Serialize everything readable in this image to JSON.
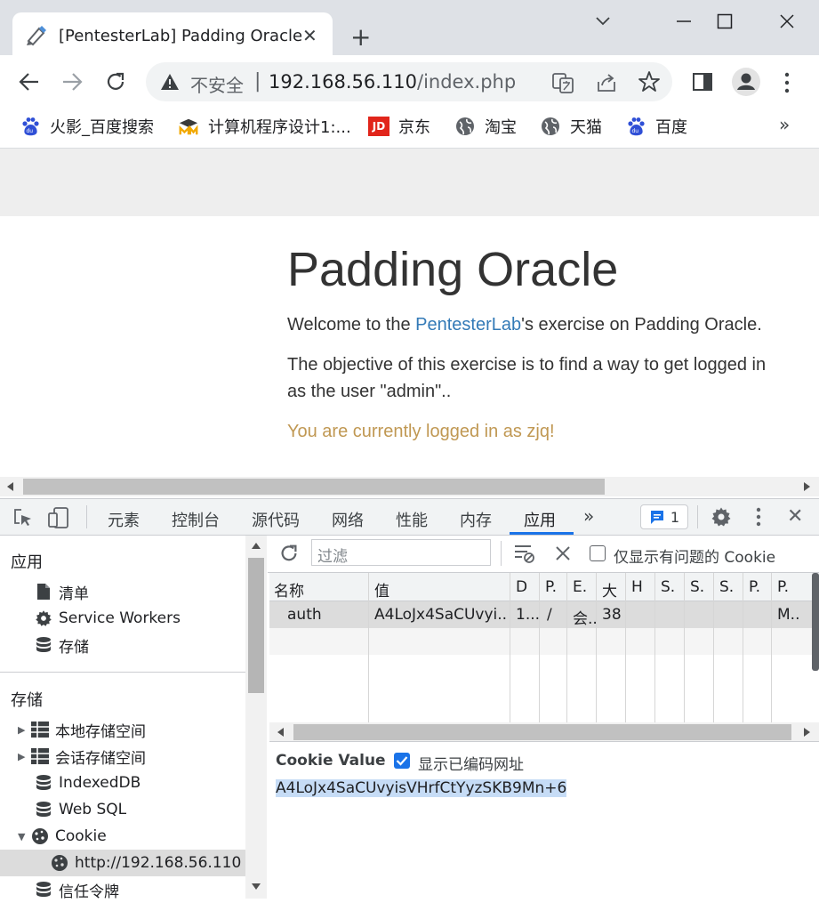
{
  "browser": {
    "tab_title": "[PentesterLab] Padding Oracle",
    "tab_close": "✕",
    "new_tab": "+",
    "security_label": "不安全",
    "address_separator": "|",
    "url_host": "192.168.56.110",
    "url_path": "/index.php",
    "more_bookmarks": "»",
    "bookmarks": [
      {
        "label": "火影_百度搜索",
        "icon": "baidu-paw-icon"
      },
      {
        "label": "计算机程序设计1:...",
        "icon": "mooc-icon"
      },
      {
        "label": "京东",
        "icon": "jd-icon"
      },
      {
        "label": "淘宝",
        "icon": "globe-icon"
      },
      {
        "label": "天猫",
        "icon": "globe-icon"
      },
      {
        "label": "百度",
        "icon": "baidu-paw-icon"
      }
    ],
    "jd_badge": "JD"
  },
  "page": {
    "title": "Padding Oracle",
    "welcome_prefix": "Welcome to the ",
    "welcome_link": "PentesterLab",
    "welcome_suffix": "'s exercise on Padding Oracle.",
    "objective_line1": "The objective of this exercise is to find a way to get logged in",
    "objective_line2": "as the user \"admin\"..",
    "status": "You are currently logged in as zjq!"
  },
  "devtools": {
    "tabs": [
      "元素",
      "控制台",
      "源代码",
      "网络",
      "性能",
      "内存",
      "应用"
    ],
    "active_tab": "应用",
    "more_tabs": "»",
    "issues_count": "1",
    "close": "✕",
    "sidebar": {
      "app_heading": "应用",
      "app_items": [
        "清单",
        "Service Workers",
        "存储"
      ],
      "storage_heading": "存储",
      "storage_items": [
        "本地存储空间",
        "会话存储空间",
        "IndexedDB",
        "Web SQL",
        "Cookie"
      ],
      "cookie_origin": "http://192.168.56.110",
      "trust_tokens": "信任令牌"
    },
    "cookies": {
      "filter_placeholder": "过滤",
      "only_issues_label": "仅显示有问题的 Cookie",
      "columns": [
        "名称",
        "值",
        "D",
        "P.",
        "E.",
        "大",
        "H",
        "S.",
        "S.",
        "S.",
        "P.",
        "P."
      ],
      "rows": [
        {
          "name": "auth",
          "value": "A4LoJx4SaCUvyi...",
          "domain": "1...",
          "path": "/",
          "expires": "会..",
          "size": "38",
          "last": "M.."
        }
      ],
      "value_label": "Cookie Value",
      "show_decoded_label": "显示已编码网址",
      "show_decoded_checked": true,
      "cookie_value": "A4LoJx4SaCUvyisVHrfCtYyzSKB9Mn+6"
    }
  },
  "colors": {
    "link": "#337ab7",
    "status": "#c09853",
    "accent": "#1a73e8"
  }
}
